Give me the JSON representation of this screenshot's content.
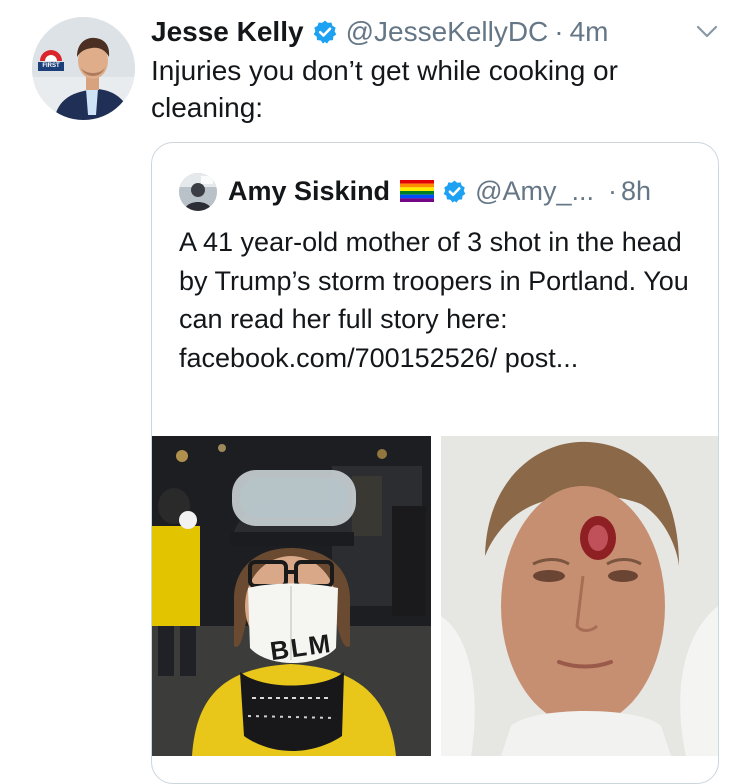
{
  "tweet": {
    "author_name": "Jesse Kelly",
    "handle": "@JesseKellyDC",
    "separator": "·",
    "time": "4m",
    "text": "Injuries you don’t get while cooking or cleaning:",
    "avatar_badge_text": "FIRST"
  },
  "quoted_tweet": {
    "author_name": "Amy Siskind",
    "handle": "@Amy_...",
    "separator": "·",
    "time": "8h",
    "text": "A 41 year-old mother of 3 shot in the head by Trump’s storm troopers in Portland. You can read her full story here: facebook.com/700152526/ post...",
    "mask_text": "BLM"
  },
  "icons": {
    "verified": "verified-badge-icon",
    "menu": "chevron-down-icon",
    "flag": "rainbow-flag-emoji"
  },
  "colors": {
    "verified_blue": "#1da1f2",
    "muted_text": "#657786",
    "border": "#ccd6dd"
  }
}
